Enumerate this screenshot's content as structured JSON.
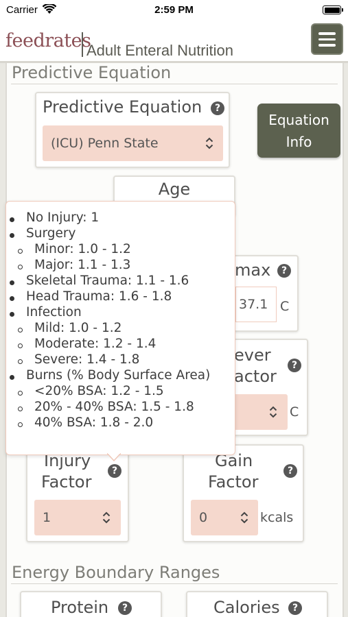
{
  "status_bar": {
    "carrier": "Carrier",
    "time": "2:59 PM"
  },
  "header": {
    "logo": "feedrates",
    "subtitle": "Adult Enteral Nutrition"
  },
  "sections": {
    "predictive": "Predictive Equation",
    "energy": "Energy Boundary Ranges"
  },
  "predictive_card": {
    "label": "Predictive Equation",
    "selected": "(ICU) Penn State"
  },
  "equation_info": {
    "line1": "Equation",
    "line2": "Info"
  },
  "age_card": {
    "label": "Age"
  },
  "tmax_card": {
    "label_partial": "max",
    "value": "37.1",
    "unit": "C"
  },
  "fever_card": {
    "line1_partial": "ever",
    "line2_partial": "actor",
    "unit": "C"
  },
  "injury_card": {
    "line1": "Injury",
    "line2": "Factor",
    "selected": "1"
  },
  "gain_card": {
    "line1": "Gain",
    "line2": "Factor",
    "selected": "0",
    "unit": "kcals"
  },
  "protein_card": {
    "label": "Protein"
  },
  "calories_card": {
    "label": "Calories"
  },
  "help_symbol": "?",
  "tooltip": {
    "items": [
      "No Injury: 1",
      "Surgery",
      "Minor: 1.0 - 1.2",
      "Major: 1.1 - 1.3",
      "Skeletal Trauma: 1.1 - 1.6",
      "Head Trauma: 1.6 - 1.8",
      "Infection",
      "Mild: 1.0 - 1.2",
      "Moderate: 1.2 - 1.4",
      "Severe: 1.4 - 1.8",
      "Burns (% Body Surface Area)",
      "<20% BSA: 1.2 - 1.5",
      "20% - 40% BSA: 1.5 - 1.8",
      "40% BSA: 1.8 - 2.0"
    ]
  },
  "colors": {
    "accent_button": "#5c614f",
    "select_fill": "#f5d8cd",
    "logo": "#8b4f55"
  }
}
